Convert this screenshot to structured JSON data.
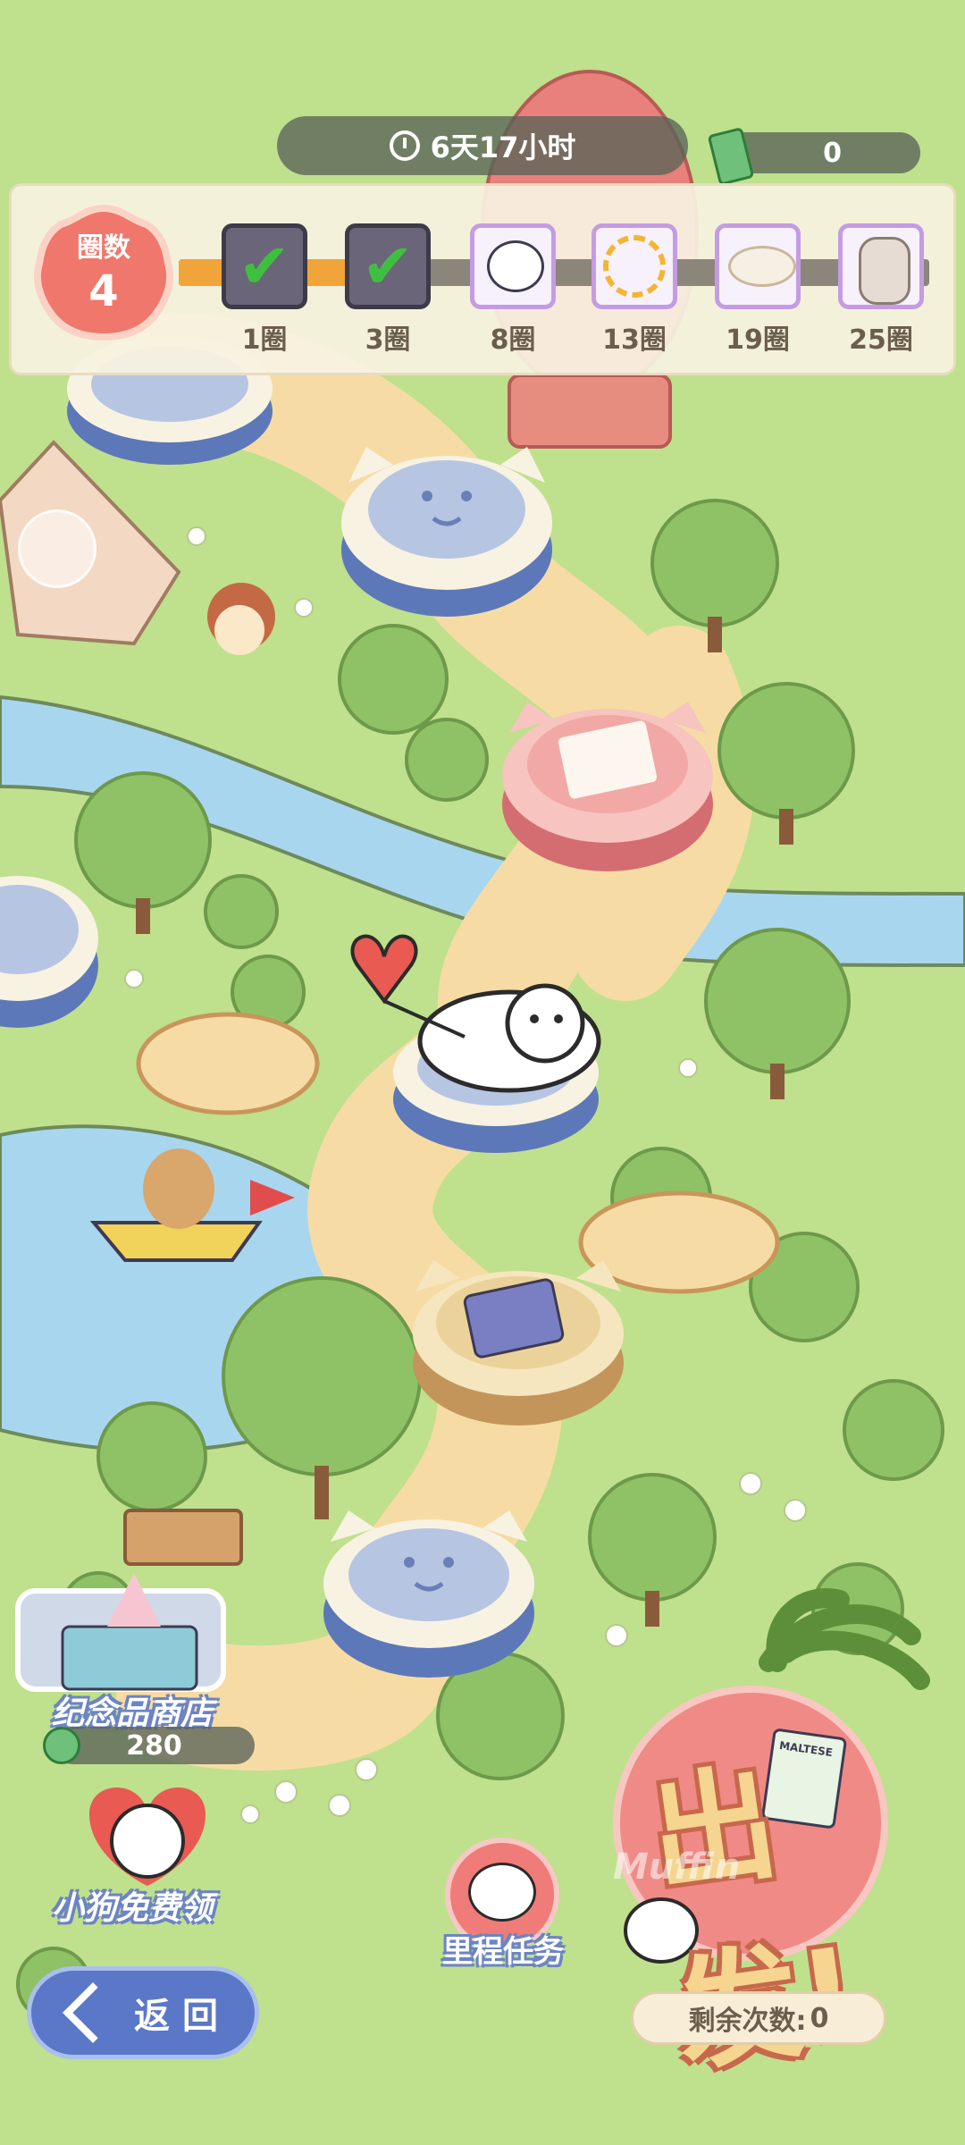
{
  "header": {
    "countdown": "6天17小时",
    "ticket_count": "0"
  },
  "progress": {
    "rounds_label": "圈数",
    "rounds_value": "4",
    "milestones": [
      {
        "label": "1圈",
        "done": true
      },
      {
        "label": "3圈",
        "done": true
      },
      {
        "label": "8圈",
        "done": false
      },
      {
        "label": "13圈",
        "done": false
      },
      {
        "label": "19圈",
        "done": false
      },
      {
        "label": "25圈",
        "done": false
      }
    ]
  },
  "shop": {
    "label": "纪念品商店",
    "coin_count": "280"
  },
  "free_dog": {
    "label": "小狗免费领"
  },
  "back_button": {
    "label": "返回"
  },
  "milestone_task": {
    "label": "里程任务"
  },
  "go_button": {
    "label": "出发!",
    "logo_text": "Muffin",
    "badge_text": "MALTESE",
    "remaining_label": "剩余次数:",
    "remaining_value": "0"
  },
  "colors": {
    "grass": "#bfe08d",
    "path": "#f6dca4",
    "river": "#a9d6ef",
    "accent_blue": "#5b77c8",
    "progress_orange": "#f1a43a"
  }
}
